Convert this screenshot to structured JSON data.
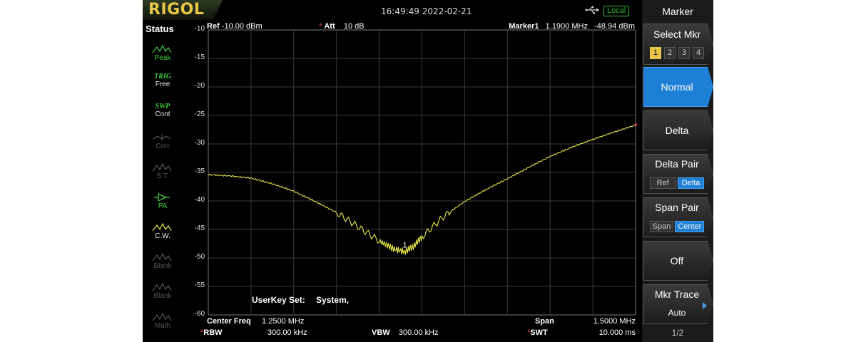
{
  "brand": "RIGOL",
  "datetime": "16:49:49 2022-02-21",
  "remote_status": "Local",
  "status_panel": {
    "title": "Status",
    "items": [
      {
        "tag": "",
        "label": "Peak",
        "enabled": true
      },
      {
        "tag": "TRIG",
        "label": "Free",
        "enabled": true
      },
      {
        "tag": "SWP",
        "label": "Cont",
        "enabled": true
      },
      {
        "tag": "",
        "label": "Corr",
        "enabled": false
      },
      {
        "tag": "",
        "label": "S.T.",
        "enabled": false
      },
      {
        "tag": "",
        "label": "PA",
        "enabled": true
      },
      {
        "tag": "",
        "label": "C.W.",
        "enabled": true
      },
      {
        "tag": "",
        "label": "Blank",
        "enabled": false
      },
      {
        "tag": "",
        "label": "Blank",
        "enabled": false
      },
      {
        "tag": "",
        "label": "Math",
        "enabled": false
      }
    ]
  },
  "header": {
    "ref_label": "Ref",
    "ref_value": "-10.00 dBm",
    "att_label": "Att",
    "att_value": "10 dB",
    "marker_label": "Marker1",
    "marker_freq": "1.1900 MHz",
    "marker_level": "-48.94 dBm"
  },
  "y_axis_labels": [
    "-10",
    "-15",
    "-20",
    "-25",
    "-30",
    "-35",
    "-40",
    "-45",
    "-50",
    "-55",
    "-60"
  ],
  "marker_number": "1",
  "userkey": {
    "label": "UserKey Set:",
    "value": "System,"
  },
  "footer": {
    "center_label": "Center Freq",
    "center_value": "1.2500 MHz",
    "span_label": "Span",
    "span_value": "1.5000 MHz",
    "rbw_label": "RBW",
    "rbw_value": "300.00 kHz",
    "vbw_label": "VBW",
    "vbw_value": "300.00 kHz",
    "swt_label": "SWT",
    "swt_value": "10.000 ms"
  },
  "menu": {
    "title": "Marker",
    "select_mkr": {
      "label": "Select Mkr",
      "options": [
        "1",
        "2",
        "3",
        "4"
      ],
      "selected": "1"
    },
    "normal": "Normal",
    "delta": "Delta",
    "delta_pair": {
      "label": "Delta Pair",
      "options": [
        "Ref",
        "Delta"
      ],
      "selected": "Delta"
    },
    "span_pair": {
      "label": "Span Pair",
      "options": [
        "Span",
        "Center"
      ],
      "selected": "Center"
    },
    "off": "Off",
    "mkr_trace": {
      "label": "Mkr Trace",
      "value": "Auto"
    },
    "page": "1/2"
  },
  "colors": {
    "trace": "#e6e64a",
    "active_button": "#1e7fd6",
    "brand": "#e8c547",
    "status_green": "#3fcf3f"
  },
  "chart_data": {
    "type": "line",
    "xlabel": "",
    "ylabel": "",
    "x_unit": "MHz",
    "y_unit": "dBm",
    "xlim": [
      0.5,
      2.0
    ],
    "ylim": [
      -60,
      -10
    ],
    "grid": true,
    "series": [
      {
        "x": [
          0.5,
          0.575,
          0.65,
          0.725,
          0.8,
          0.875,
          0.95,
          1.025,
          1.1,
          1.15,
          1.19,
          1.22,
          1.25,
          1.325,
          1.4,
          1.475,
          1.55,
          1.625,
          1.7,
          1.775,
          1.85,
          1.925,
          2.0
        ],
        "y": [
          -35.4,
          -35.6,
          -36.0,
          -37.0,
          -38.3,
          -40.1,
          -42.0,
          -44.5,
          -47.0,
          -48.4,
          -48.9,
          -48.0,
          -46.3,
          -42.8,
          -40.1,
          -38.0,
          -36.1,
          -34.1,
          -32.2,
          -30.6,
          -29.2,
          -27.9,
          -26.7
        ]
      }
    ],
    "marker": {
      "x": 1.19,
      "y": -48.94,
      "label": "1"
    }
  }
}
